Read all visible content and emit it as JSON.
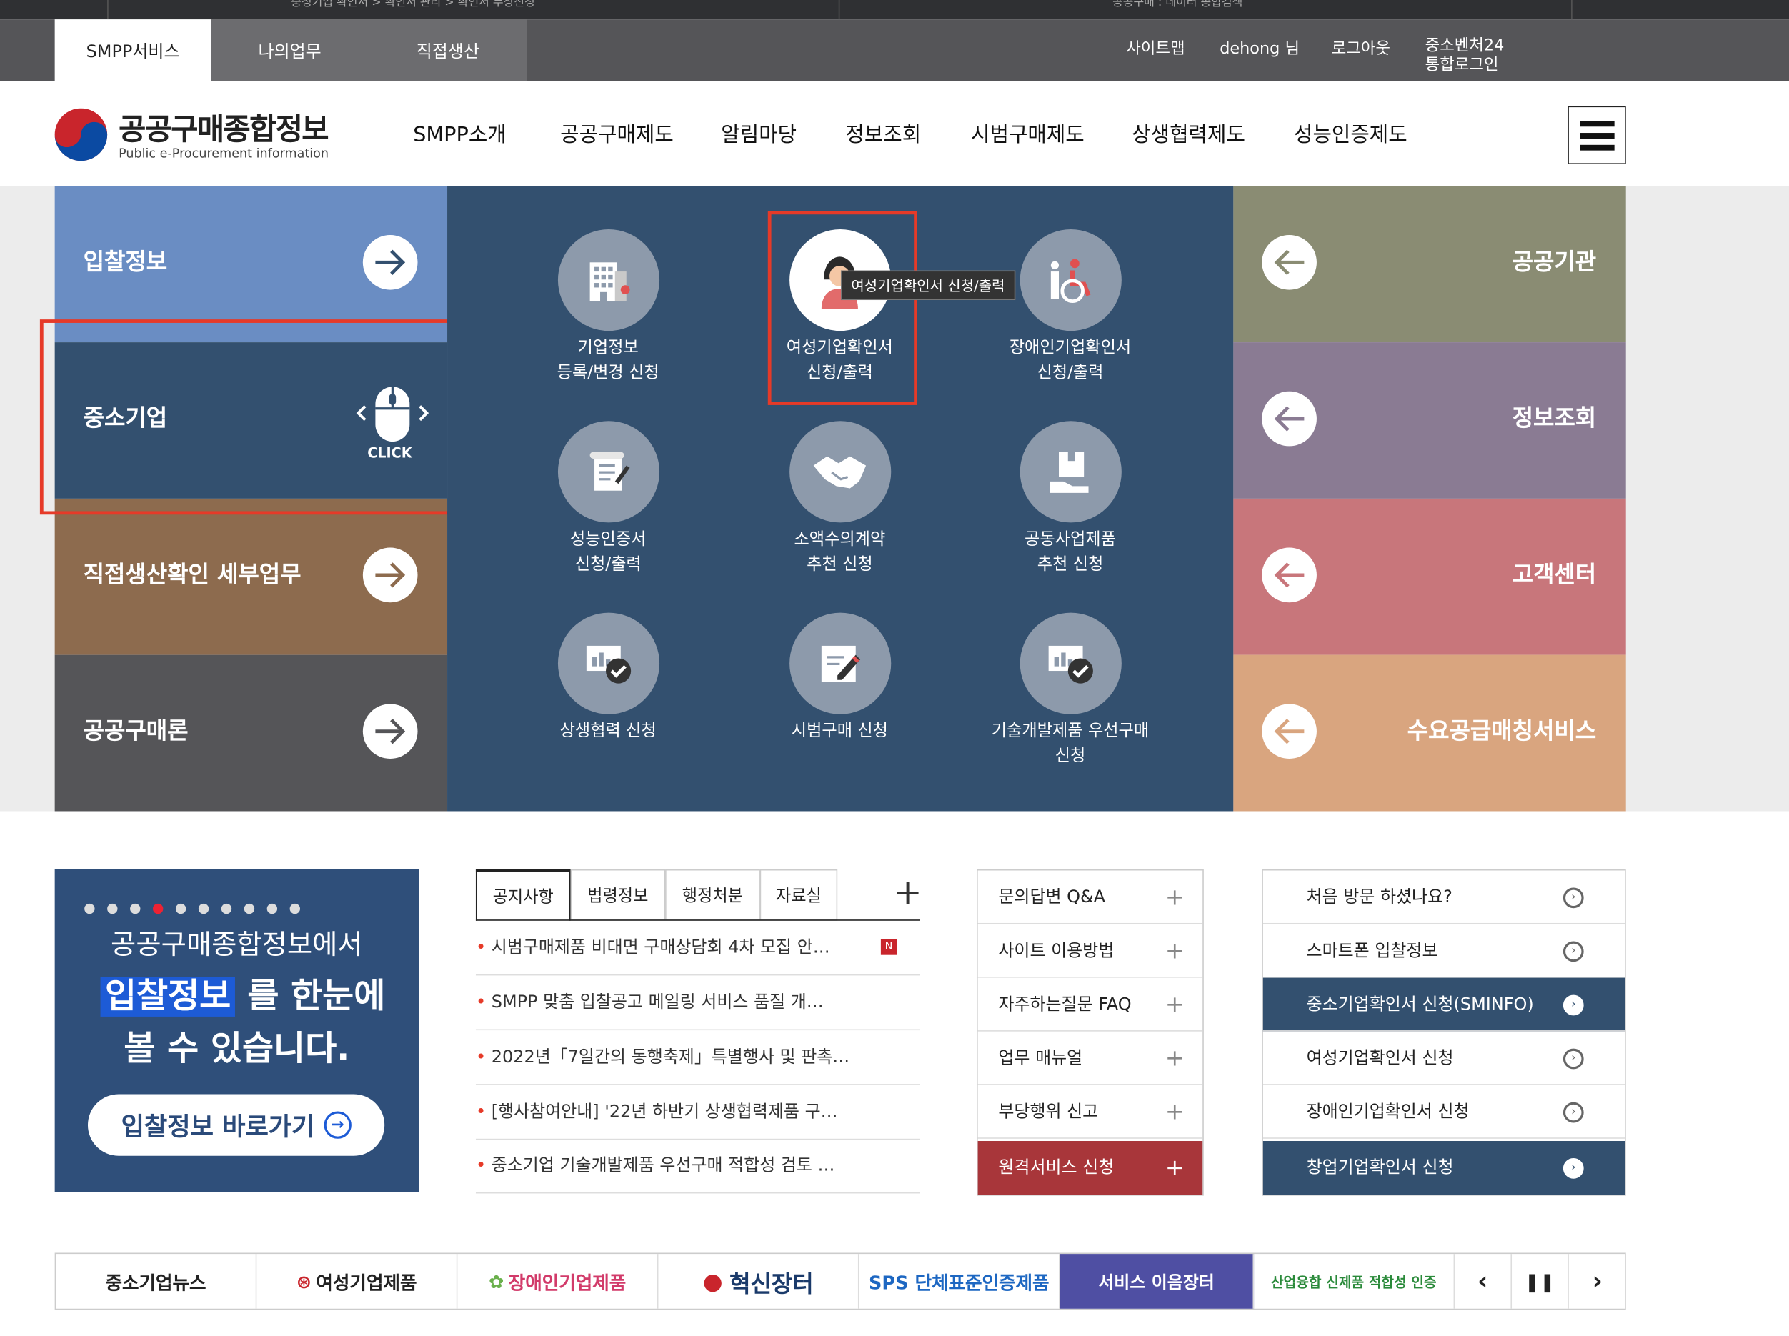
{
  "browser_tabs": [
    "중성기업 확인서 > 확인서 관리 > 확인서 무상신청",
    "공공구매 : 데이터 종합검색"
  ],
  "topnav": {
    "items": [
      "SMPP서비스",
      "나의업무",
      "직접생산"
    ],
    "right": [
      "사이트맵",
      "dehong 님",
      "로그아웃"
    ],
    "sso": [
      "중소벤처24",
      "통합로그인"
    ]
  },
  "logo": {
    "title": "공공구매종합정보",
    "subtitle": "Public e-Procurement information"
  },
  "gnb": [
    "SMPP소개",
    "공공구매제도",
    "알림마당",
    "정보조회",
    "시범구매제도",
    "상생협력제도",
    "성능인증제도"
  ],
  "left_menu": [
    "입찰정보",
    "중소기업",
    "직접생산확인 세부업무",
    "공공구매론"
  ],
  "click_label": "CLICK",
  "services": [
    [
      "기업정보",
      "등록/변경 신청"
    ],
    [
      "여성기업확인서",
      "신청/출력"
    ],
    [
      "장애인기업확인서",
      "신청/출력"
    ],
    [
      "성능인증서",
      "신청/출력"
    ],
    [
      "소액수의계약",
      "추천 신청"
    ],
    [
      "공동사업제품",
      "추천 신청"
    ],
    [
      "상생협력 신청",
      ""
    ],
    [
      "시범구매 신청",
      ""
    ],
    [
      "기술개발제품 우선구매",
      "신청"
    ]
  ],
  "tooltip": "여성기업확인서 신청/출력",
  "right_menu": [
    "공공기관",
    "정보조회",
    "고객센터",
    "수요공급매칭서비스"
  ],
  "banner": {
    "line1": "공공구매종합정보에서",
    "highlight": "입찰정보",
    "line2": "를 한눈에",
    "line3": "볼 수 있습니다.",
    "button": "입찰정보 바로가기"
  },
  "notice_tabs": [
    "공지사항",
    "법령정보",
    "행정처분",
    "자료실"
  ],
  "plus": "+",
  "new_badge": "N",
  "notices": [
    "시범구매제품 비대면 구매상담회 4차 모집 안…",
    "SMPP 맞춤 입찰공고 메일링 서비스 품질 개…",
    "2022년「7일간의 동행축제」특별행사 및 판촉…",
    "[행사참여안내] '22년 하반기 상생협력제품 구…",
    "중소기업 기술개발제품 우선구매 적합성 검토 …"
  ],
  "qa_links": [
    "문의답변 Q&A",
    "사이트 이용방법",
    "자주하는질문 FAQ",
    "업무 매뉴얼",
    "부당행위 신고",
    "원격서비스 신청"
  ],
  "quick_links": [
    "처음 방문 하셨나요?",
    "스마트폰 입찰정보",
    "중소기업확인서 신청(SMINFO)",
    "여성기업확인서 신청",
    "장애인기업확인서 신청",
    "창업기업확인서 신청"
  ],
  "partner_logos": [
    "중소기업뉴스",
    "여성기업제품",
    "장애인기업제품",
    "혁신장터",
    "SPS 단체표준인증제품",
    "서비스 이음장터",
    "산업융합 신제품 적합성 인증"
  ],
  "colors": {
    "accent_red": "#e63a28",
    "navy": "#33506f",
    "left": [
      "#6a8dc3",
      "#33506f",
      "#8d6b4e",
      "#555558"
    ],
    "right": [
      "#8a8c73",
      "#8a7b93",
      "#c8767b",
      "#d9a57f"
    ],
    "remote": "#a8363a"
  }
}
